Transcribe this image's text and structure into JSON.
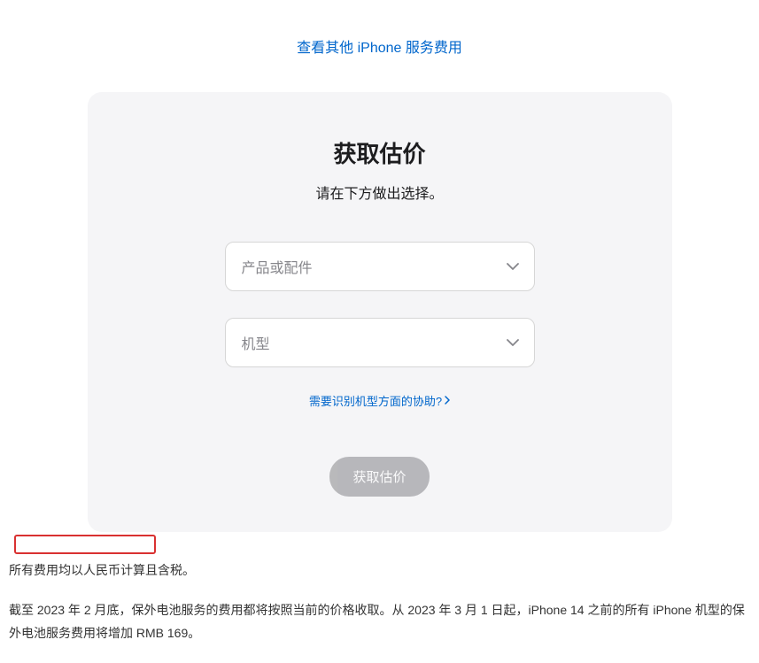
{
  "topLink": "查看其他 iPhone 服务费用",
  "card": {
    "title": "获取估价",
    "subtitle": "请在下方做出选择。",
    "selectProduct": "产品或配件",
    "selectModel": "机型",
    "helpLink": "需要识别机型方面的协助?",
    "submit": "获取估价"
  },
  "footer": {
    "line1": "所有费用均以人民币计算且含税。",
    "line2": "截至 2023 年 2 月底，保外电池服务的费用都将按照当前的价格收取。从 2023 年 3 月 1 日起，iPhone 14 之前的所有 iPhone 机型的保外电池服务费用将增加 RMB 169。"
  }
}
